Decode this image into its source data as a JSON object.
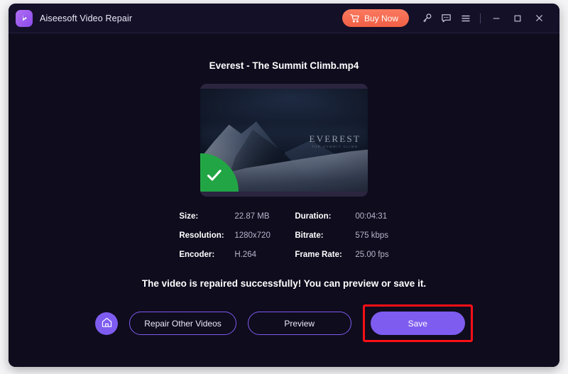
{
  "window": {
    "app_title": "Aiseesoft Video Repair",
    "logo_icon": "aiseesoft-play-logo"
  },
  "titlebar": {
    "buy_now_label": "Buy Now",
    "cart_icon": "shopping-cart-icon",
    "key_icon": "key-icon",
    "chat_icon": "chat-bubble-icon",
    "menu_icon": "hamburger-menu-icon",
    "minimize_icon": "minimize-icon",
    "maximize_icon": "maximize-icon",
    "close_icon": "close-icon"
  },
  "video": {
    "file_name": "Everest - The Summit Climb.mp4",
    "overlay_title": "EVEREST",
    "overlay_subtitle": "THE SUMMIT CLIMB",
    "success_badge_icon": "check-mark-icon"
  },
  "metadata": [
    {
      "label": "Size:",
      "value": "22.87 MB"
    },
    {
      "label": "Duration:",
      "value": "00:04:31"
    },
    {
      "label": "Resolution:",
      "value": "1280x720"
    },
    {
      "label": "Bitrate:",
      "value": "575 kbps"
    },
    {
      "label": "Encoder:",
      "value": "H.264"
    },
    {
      "label": "Frame Rate:",
      "value": "25.00 fps"
    }
  ],
  "status": {
    "message": "The video is repaired successfully! You can preview or save it."
  },
  "actions": {
    "home_icon": "home-icon",
    "repair_other_label": "Repair Other Videos",
    "preview_label": "Preview",
    "save_label": "Save"
  },
  "colors": {
    "window_bg": "#0f0c1d",
    "titlebar_bg": "#131028",
    "accent_purple": "#7e5cf0",
    "buy_now_orange": "#f05f44",
    "success_green": "#22a645",
    "highlight_red": "#fb0f16"
  }
}
